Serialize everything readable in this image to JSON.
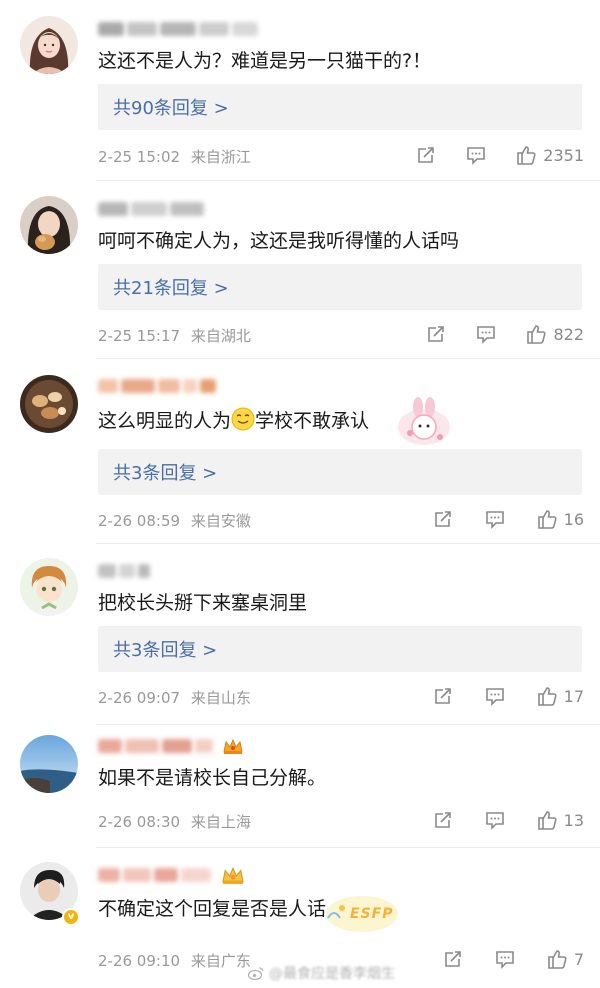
{
  "comments": [
    {
      "text": "这还不是人为？难道是另一只猫干的?！",
      "reply": "共90条回复 >",
      "date": "2-25 15:02",
      "location": "来自浙江",
      "likes": "2351"
    },
    {
      "text": "呵呵不确定人为，这还是我听得懂的人话吗",
      "reply": "共21条回复 >",
      "date": "2-25 15:17",
      "location": "来自湖北",
      "likes": "822"
    },
    {
      "text_before": "这么明显的人为",
      "text_after": "学校不敢承认",
      "reply": "共3条回复 >",
      "date": "2-26 08:59",
      "location": "来自安徽",
      "likes": "16"
    },
    {
      "text": "把校长头掰下来塞桌洞里",
      "reply": "共3条回复 >",
      "date": "2-26 09:07",
      "location": "来自山东",
      "likes": "17"
    },
    {
      "text": "如果不是请校长自己分解。",
      "date": "2-26 08:30",
      "location": "来自上海",
      "likes": "13"
    },
    {
      "text": "不确定这个回复是否是人话",
      "date": "2-26 09:10",
      "location": "来自广东",
      "likes": "7",
      "sticker_text": "ESFP"
    }
  ],
  "watermark": "@最食应是香李烟生",
  "colors": {
    "reply_link": "#4a6ea9",
    "meta_gray": "#999999",
    "reply_bg": "#f2f2f2",
    "gold": "#f5b40c"
  },
  "icons": [
    "share-icon",
    "comment-icon",
    "like-icon",
    "crown-icon",
    "verified-badge-icon",
    "weibo-logo-icon"
  ]
}
